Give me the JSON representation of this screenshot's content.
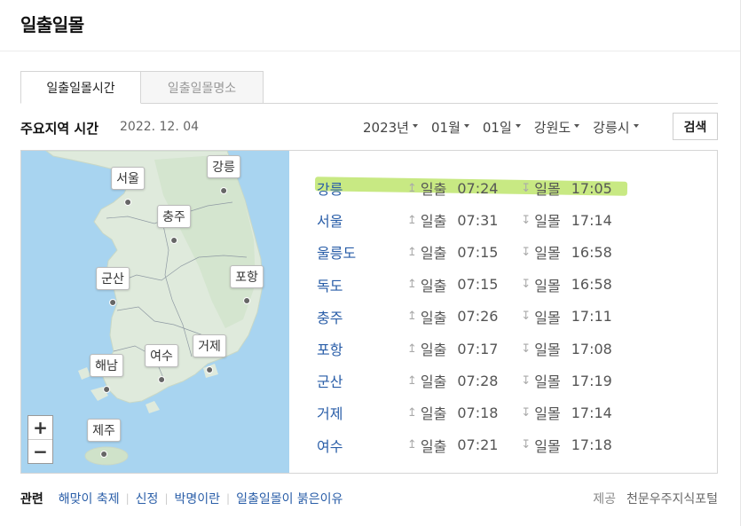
{
  "page": {
    "title": "일출일몰"
  },
  "tabs": [
    {
      "label": "일출일몰시간",
      "active": true
    },
    {
      "label": "일출일몰명소",
      "active": false
    }
  ],
  "section": {
    "title": "주요지역 시간",
    "date": "2022. 12. 04"
  },
  "filters": {
    "year": "2023년",
    "month": "01월",
    "day": "01일",
    "province": "강원도",
    "city": "강릉시"
  },
  "search_label": "검색",
  "map": {
    "labels": {
      "gangneung": "강릉",
      "seoul": "서울",
      "chungju": "충주",
      "pohang": "포항",
      "gunsan": "군산",
      "haenam": "해남",
      "yeosu": "여수",
      "geoje": "거제",
      "jeju": "제주"
    },
    "zoom_in": "+",
    "zoom_out": "−"
  },
  "sun_label": {
    "rise": "일출",
    "set": "일몰"
  },
  "rows": [
    {
      "city": "강릉",
      "rise": "07:24",
      "set": "17:05",
      "highlighted": true
    },
    {
      "city": "서울",
      "rise": "07:31",
      "set": "17:14"
    },
    {
      "city": "울릉도",
      "rise": "07:15",
      "set": "16:58"
    },
    {
      "city": "독도",
      "rise": "07:15",
      "set": "16:58"
    },
    {
      "city": "충주",
      "rise": "07:26",
      "set": "17:11"
    },
    {
      "city": "포항",
      "rise": "07:17",
      "set": "17:08"
    },
    {
      "city": "군산",
      "rise": "07:28",
      "set": "17:19"
    },
    {
      "city": "거제",
      "rise": "07:18",
      "set": "17:14"
    },
    {
      "city": "여수",
      "rise": "07:21",
      "set": "17:18"
    }
  ],
  "related": {
    "title": "관련",
    "links": [
      "해맞이 축제",
      "신정",
      "박명이란",
      "일출일몰이 붉은이유"
    ]
  },
  "source": {
    "label": "제공",
    "name": "천문우주지식포털"
  },
  "colors": {
    "link": "#2a5ea8",
    "highlight": "#b6e15a",
    "sea": "#a8d4f0",
    "land": "#dfeadc"
  }
}
